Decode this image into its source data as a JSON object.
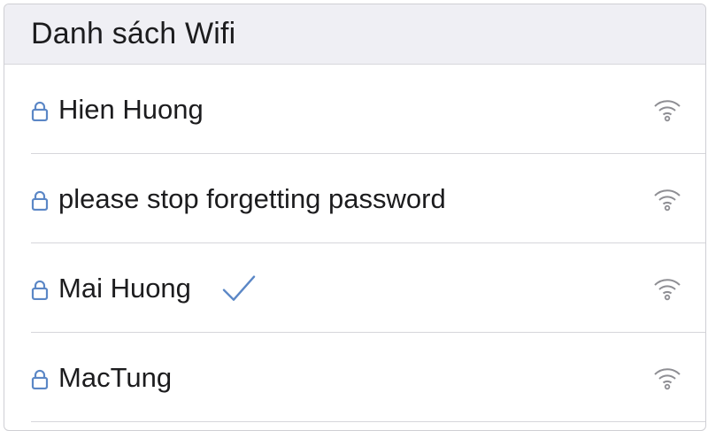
{
  "header": {
    "title": "Danh sách Wifi"
  },
  "networks": [
    {
      "name": "Hien Huong",
      "secured": true,
      "connected": false,
      "icon": "wifi-icon"
    },
    {
      "name": "please stop forgetting password",
      "secured": true,
      "connected": false,
      "icon": "wifi-icon"
    },
    {
      "name": "Mai Huong",
      "secured": true,
      "connected": true,
      "icon": "wifi-icon"
    },
    {
      "name": "MacTung",
      "secured": true,
      "connected": false,
      "icon": "wifi-icon"
    }
  ],
  "colors": {
    "accent": "#5b87c6",
    "header_bg": "#efeff4",
    "text": "#1c1c1e",
    "divider": "#d6d6db",
    "wifi_icon": "#8e8e93"
  }
}
